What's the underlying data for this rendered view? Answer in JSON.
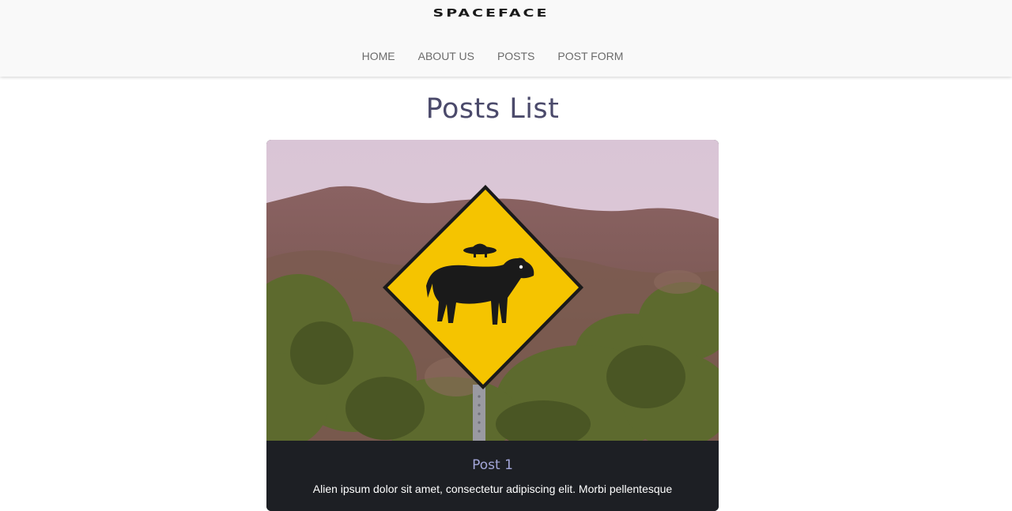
{
  "header": {
    "logo_text": "SPACEFACE",
    "nav": [
      {
        "label": "HOME"
      },
      {
        "label": "ABOUT US"
      },
      {
        "label": "POSTS"
      },
      {
        "label": "POST FORM"
      }
    ]
  },
  "main": {
    "title": "Posts List",
    "posts": [
      {
        "title": "Post 1",
        "excerpt": "Alien ipsum dolor sit amet, consectetur adipiscing elit. Morbi pellentesque",
        "image_icon": "cow-ufo-crossing-sign-photo"
      }
    ]
  },
  "colors": {
    "header_bg": "#f9f9f9",
    "nav_text": "#6b6b6b",
    "title_text": "#4b4a6b",
    "card_bg": "#1d1f24",
    "card_title": "#a3a6d9",
    "sign_yellow": "#f5c400"
  }
}
